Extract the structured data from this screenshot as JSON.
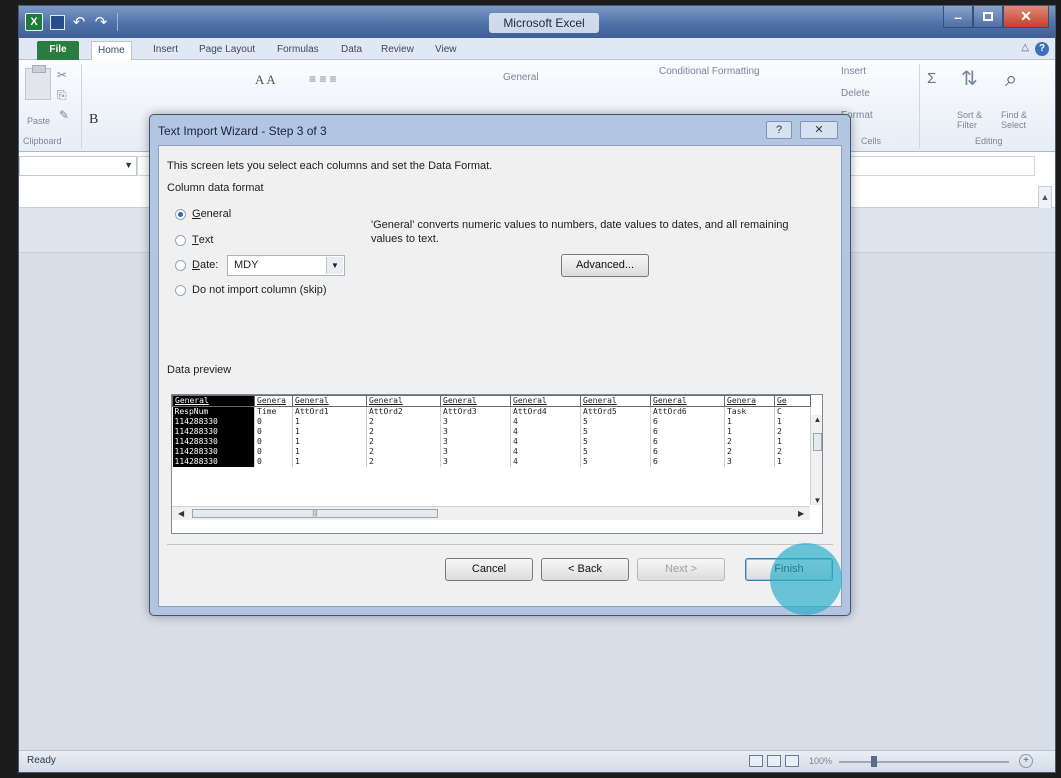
{
  "app": {
    "title": "Microsoft Excel",
    "quick_access": {
      "icon_label": "X",
      "undo": "↶",
      "redo": "↷"
    },
    "window_controls": {
      "minimize": "–",
      "close": "✕"
    }
  },
  "ribbon": {
    "tabs": [
      "File",
      "Home",
      "Insert",
      "Page Layout",
      "Formulas",
      "Data",
      "Review",
      "View"
    ],
    "groups": {
      "clipboard_label": "Clipboard",
      "paste_label": "Paste",
      "bold": "B",
      "font_size_buttons": "A A",
      "number_format": "General",
      "conditional_formatting": "Conditional Formatting",
      "insert": "Insert",
      "delete": "Delete",
      "format": "Format",
      "cells_label": "Cells",
      "sort_filter": "Sort & Filter",
      "find_select": "Find & Select",
      "editing_label": "Editing",
      "sigma": "Σ"
    }
  },
  "status": {
    "text": "Ready",
    "zoom": "100%"
  },
  "dialog": {
    "title": "Text Import Wizard - Step 3 of 3",
    "help": "?",
    "close": "✕",
    "intro": "This screen lets you select each columns and set the Data Format.",
    "column_data_format_label": "Column data format",
    "options": [
      {
        "key": "G",
        "rest": "eneral",
        "selected": true
      },
      {
        "key": "T",
        "rest": "ext",
        "selected": false
      },
      {
        "key": "D",
        "rest": "ate:",
        "selected": false
      },
      {
        "key": "",
        "rest": "Do not import column (skip)",
        "selected": false
      }
    ],
    "date_format": "MDY",
    "general_description": "'General' converts numeric values to numbers, date values to dates, and all remaining values to text.",
    "advanced_button": "Advanced...",
    "data_preview_label": "Data preview",
    "preview": {
      "headers": [
        "General",
        "Genera",
        "General",
        "General",
        "General",
        "General",
        "General",
        "General",
        "Genera",
        "Ge"
      ],
      "rows": [
        [
          "RespNum",
          "Time",
          "AttOrd1",
          "AttOrd2",
          "AttOrd3",
          "AttOrd4",
          "AttOrd5",
          "AttOrd6",
          "Task",
          "C"
        ],
        [
          "114288330",
          "0",
          "1",
          "2",
          "3",
          "4",
          "5",
          "6",
          "1",
          "1"
        ],
        [
          "114288330",
          "0",
          "1",
          "2",
          "3",
          "4",
          "5",
          "6",
          "1",
          "2"
        ],
        [
          "114288330",
          "0",
          "1",
          "2",
          "3",
          "4",
          "5",
          "6",
          "2",
          "1"
        ],
        [
          "114288330",
          "0",
          "1",
          "2",
          "3",
          "4",
          "5",
          "6",
          "2",
          "2"
        ],
        [
          "114288330",
          "0",
          "1",
          "2",
          "3",
          "4",
          "5",
          "6",
          "3",
          "1"
        ]
      ]
    },
    "buttons": {
      "cancel": "Cancel",
      "back": "< Back",
      "next": "Next >",
      "finish": "Finish"
    }
  },
  "colors": {
    "titlebar": "#4f72a9",
    "file_tab": "#2a7d3e",
    "click_marker": "#28afc8",
    "dialog_frame": "#b0c4e0"
  }
}
